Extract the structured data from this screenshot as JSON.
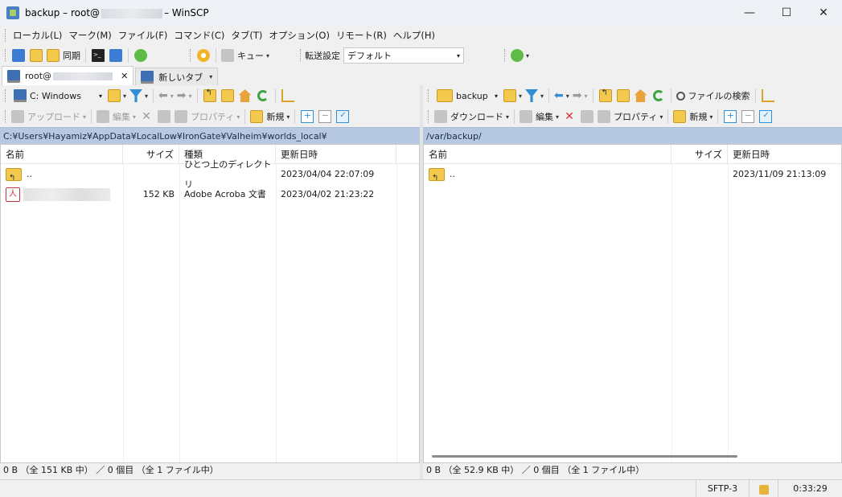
{
  "window": {
    "title_prefix": "backup – root@",
    "title_suffix": "– WinSCP",
    "minimize": "—",
    "maximize": "☐",
    "close": "✕"
  },
  "menu": [
    "ローカル(L)",
    "マーク(M)",
    "ファイル(F)",
    "コマンド(C)",
    "タブ(T)",
    "オプション(O)",
    "リモート(R)",
    "ヘルプ(H)"
  ],
  "main_toolbar": {
    "sync_label": "同期",
    "queue_label": "キュー",
    "transfer_settings_label": "転送設定",
    "transfer_preset": "デフォルト"
  },
  "tabs": {
    "session_prefix": "root@",
    "session_close": "✕",
    "new_tab": "新しいタブ"
  },
  "left_panel": {
    "drive": "C: Windows",
    "upload_label": "アップロード",
    "edit_label": "編集",
    "properties_label": "プロパティ",
    "new_label": "新規",
    "path": "C:¥Users¥Hayamiz¥AppData¥LocalLow¥IronGate¥Valheim¥worlds_local¥",
    "columns": [
      "名前",
      "サイズ",
      "種類",
      "更新日時"
    ],
    "rows": [
      {
        "name": "..",
        "size": "",
        "type": "ひとつ上のディレクトリ",
        "modified": "2023/04/04 22:07:09"
      },
      {
        "name": "",
        "size": "152 KB",
        "type": "Adobe Acroba 文書",
        "modified": "2023/04/02 21:23:22"
      }
    ],
    "status": "0 B （全 151 KB 中） ／ 0 個目 （全 1 ファイル中）"
  },
  "right_panel": {
    "folder": "backup",
    "find_files_label": "ファイルの検索",
    "download_label": "ダウンロード",
    "edit_label": "編集",
    "properties_label": "プロパティ",
    "new_label": "新規",
    "path": "/var/backup/",
    "columns": [
      "名前",
      "サイズ",
      "更新日時"
    ],
    "rows": [
      {
        "name": "..",
        "size": "",
        "modified": "2023/11/09 21:13:09"
      }
    ],
    "status": "0 B （全 52.9 KB 中） ／ 0 個目 （全 1 ファイル中）"
  },
  "statusbar": {
    "protocol": "SFTP-3",
    "elapsed": "0:33:29"
  },
  "icon_glyphs": {
    "dropdown": "▾",
    "arrow_left": "⬅",
    "arrow_right": "➡",
    "plus": "+",
    "minus": "−",
    "check": "✓",
    "pdf": "人"
  }
}
